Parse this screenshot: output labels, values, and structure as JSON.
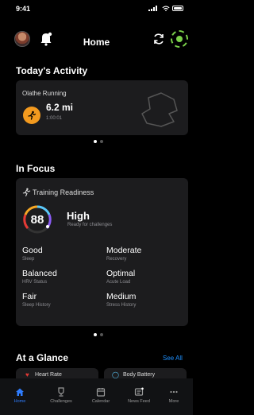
{
  "status_bar": {
    "time": "9:41"
  },
  "header": {
    "title": "Home"
  },
  "todays_activity": {
    "title": "Today's Activity",
    "activity_name": "Olathe Running",
    "distance": "6.2 mi",
    "duration": "1:00:01"
  },
  "in_focus": {
    "title": "In Focus",
    "card_title": "Training Readiness",
    "score": "88",
    "level": "High",
    "level_sub": "Ready for challenges",
    "score_fraction": 0.88,
    "metrics": [
      {
        "value": "Good",
        "label": "Sleep"
      },
      {
        "value": "Moderate",
        "label": "Recovery"
      },
      {
        "value": "Balanced",
        "label": "HRV Status"
      },
      {
        "value": "Optimal",
        "label": "Acute Load"
      },
      {
        "value": "Fair",
        "label": "Sleep History"
      },
      {
        "value": "Medium",
        "label": "Stress History"
      }
    ]
  },
  "at_a_glance": {
    "title": "At a Glance",
    "see_all": "See All",
    "cards": [
      "Heart Rate",
      "Body Battery"
    ]
  },
  "tabs": [
    {
      "label": "Home",
      "icon": "home-icon",
      "active": true
    },
    {
      "label": "Challenges",
      "icon": "challenges-icon",
      "active": false
    },
    {
      "label": "Calendar",
      "icon": "calendar-icon",
      "active": false
    },
    {
      "label": "News Feed",
      "icon": "news-feed-icon",
      "active": false
    },
    {
      "label": "More",
      "icon": "more-icon",
      "active": false
    }
  ],
  "colors": {
    "accent": "#2f7dff",
    "run": "#f39a1f",
    "see_all": "#1e90ff",
    "device": "#7bd14a"
  }
}
